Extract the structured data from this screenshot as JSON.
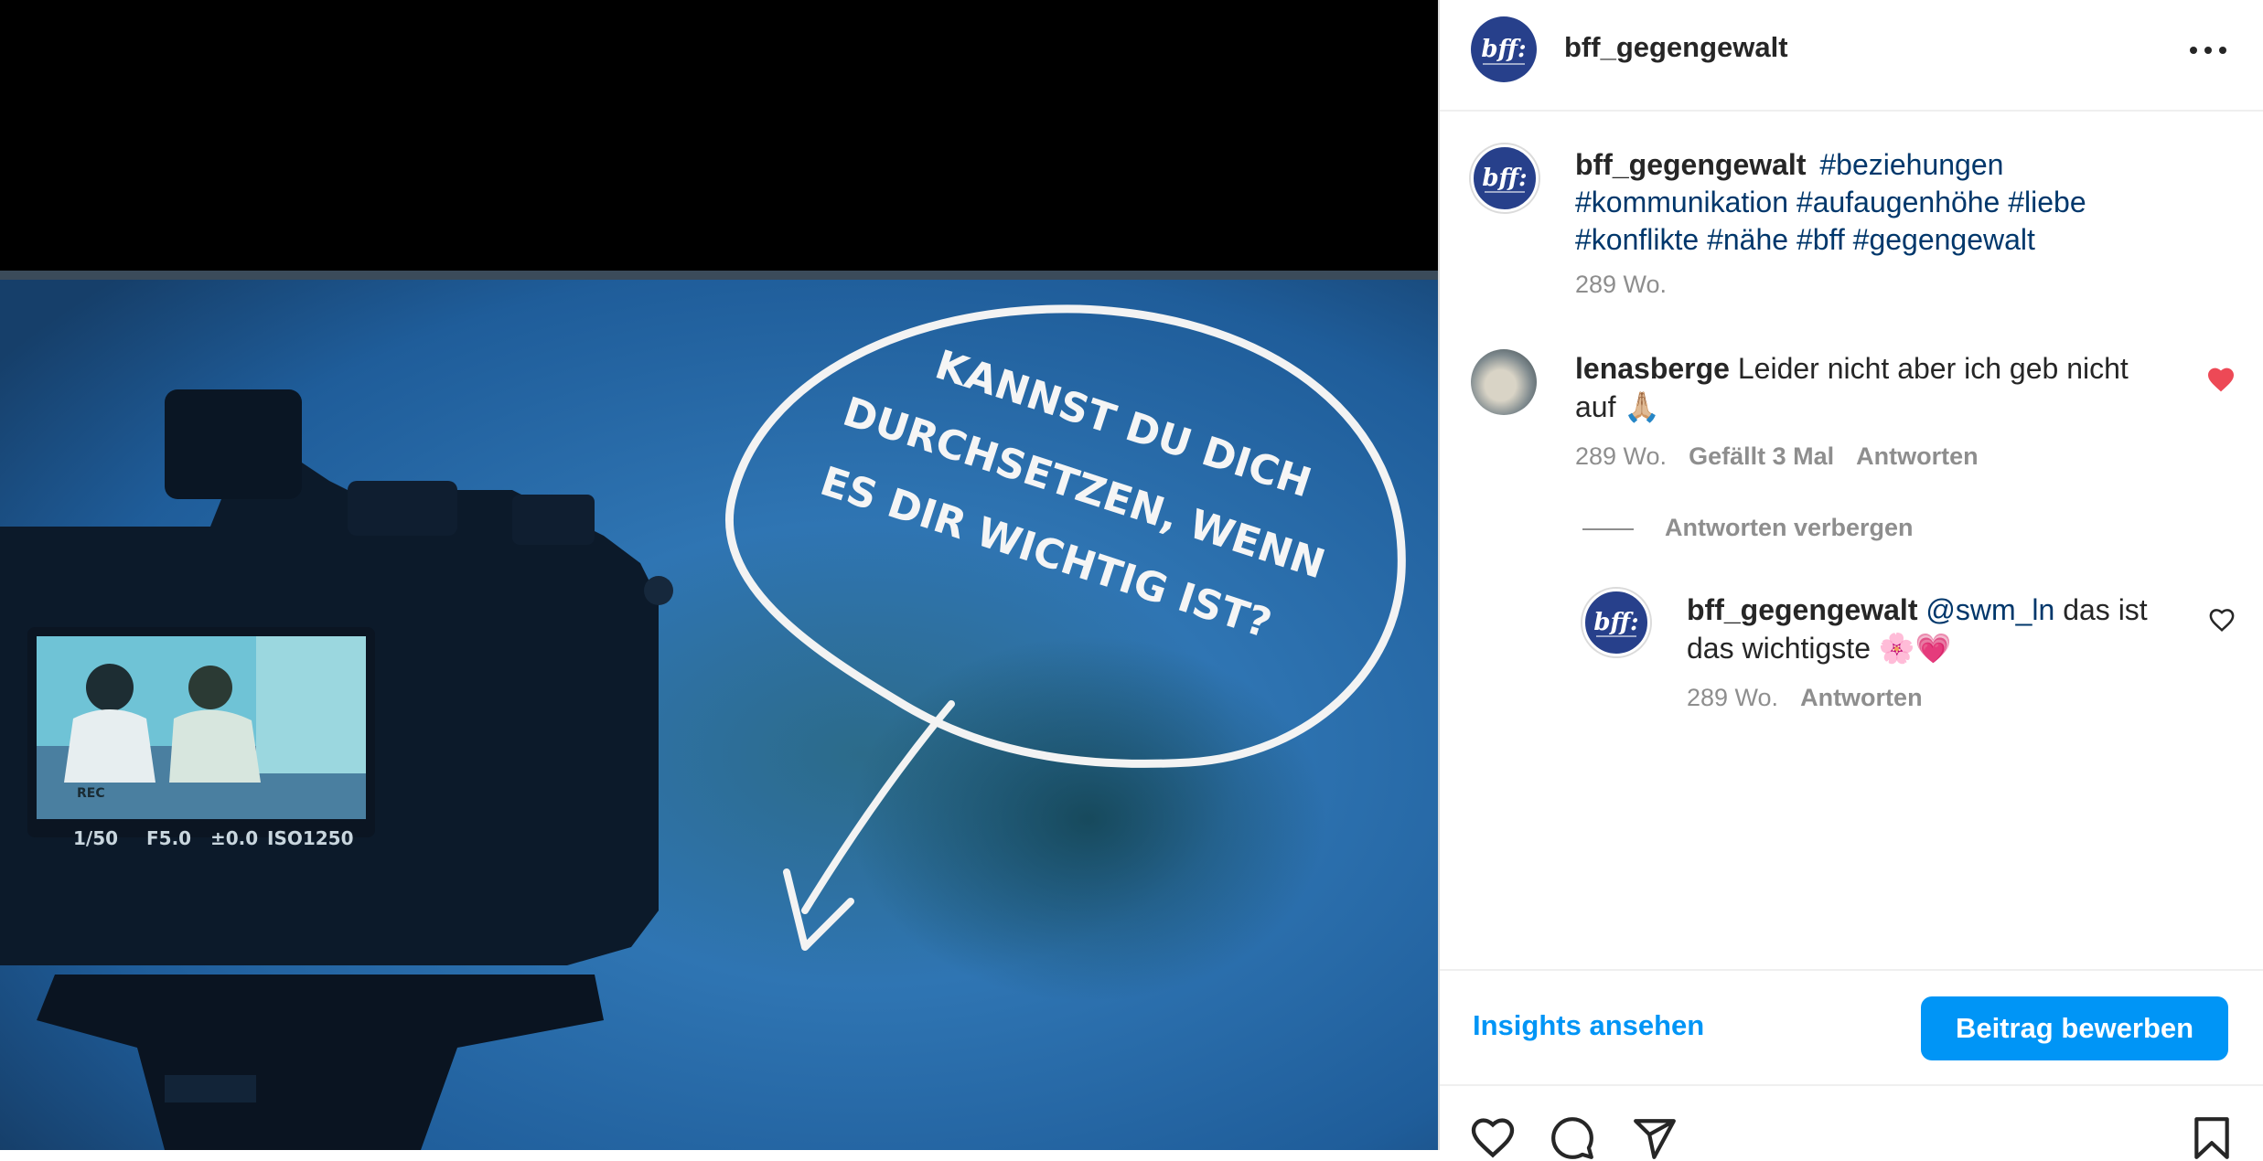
{
  "media": {
    "speech_bubble_lines": [
      "KANNST DU DICH",
      "DURCHSETZEN, WENN",
      "ES DIR WICHTIG IST?"
    ],
    "camera_readout": [
      "1/50",
      "F5.0",
      "±0.0",
      "ISO1250"
    ],
    "camera_rec_label": "REC"
  },
  "header": {
    "avatar_text": "bff:",
    "username": "bff_gegengewalt",
    "more_icon": "more-horizontal-icon"
  },
  "caption": {
    "avatar_text": "bff:",
    "username": "bff_gegengewalt",
    "hashtags": [
      "#beziehungen",
      "#kommunikation",
      "#aufaugenhöhe",
      "#liebe",
      "#konflikte",
      "#nähe",
      "#bff",
      "#gegengewalt"
    ],
    "age": "289 Wo."
  },
  "comment": {
    "username": "lenasberge",
    "text": "Leider nicht aber ich geb nicht auf 🙏🏼",
    "age": "289 Wo.",
    "likes": "Gefällt 3 Mal",
    "reply": "Antworten",
    "liked": true
  },
  "toggle_replies": "Antworten verbergen",
  "reply": {
    "avatar_text": "bff:",
    "username": "bff_gegengewalt",
    "mention": "@swm_ln",
    "text": "das ist das wichtigste 🌸💗",
    "age": "289 Wo.",
    "reply": "Antworten"
  },
  "actions": {
    "insights": "Insights ansehen",
    "promote": "Beitrag bewerben"
  },
  "icons": [
    "heart-icon",
    "comment-icon",
    "share-icon",
    "bookmark-icon"
  ],
  "colors": {
    "accent": "#0095f6",
    "hashtag": "#00376b",
    "like": "#ed4956",
    "brand": "#27408b"
  }
}
